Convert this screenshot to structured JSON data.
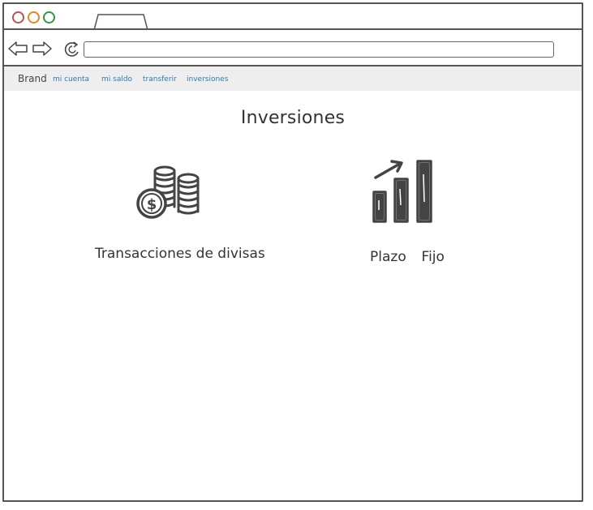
{
  "browser": {
    "url": "",
    "colors": {
      "close": "#c0504d",
      "minimize": "#e08a1e",
      "maximize": "#2c9a3c"
    }
  },
  "navbar": {
    "brand": "Brand",
    "links": [
      "mi cuenta",
      "mi saldo",
      "transferir",
      "inversiones"
    ],
    "link_color": "#2b7ab8"
  },
  "main": {
    "title": "Inversiones",
    "cards": [
      {
        "label": "Transacciones de divisas",
        "icon": "coins-icon"
      },
      {
        "label": "Plazo  Fijo",
        "icon": "growth-chart-icon"
      }
    ]
  }
}
